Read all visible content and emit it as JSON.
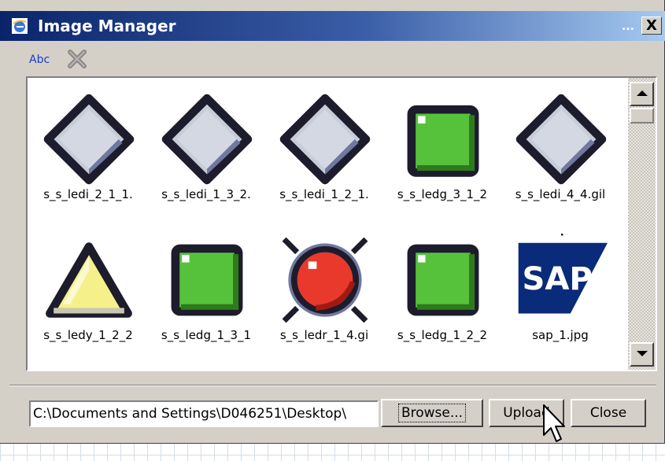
{
  "window": {
    "title": "Image Manager",
    "title_dots": "...",
    "close_glyph": "X",
    "colors": {
      "titlebar_start": "#0a246a",
      "titlebar_end": "#a6caf0",
      "face": "#d4d0c8"
    }
  },
  "toolbar": {
    "spellcheck_icon": "abc-spellcheck-icon",
    "spellcheck_glyph": "Abc",
    "delete_icon": "delete-x-icon"
  },
  "thumbnails": [
    {
      "label": "s_s_ledi_2_1_1.",
      "icon": "led-inactive-diamond"
    },
    {
      "label": "s_s_ledi_1_3_2.",
      "icon": "led-inactive-diamond"
    },
    {
      "label": "s_s_ledi_1_2_1.",
      "icon": "led-inactive-diamond"
    },
    {
      "label": "s_s_ledg_3_1_2",
      "icon": "led-green-square"
    },
    {
      "label": "s_s_ledi_4_4.gil",
      "icon": "led-inactive-diamond"
    },
    {
      "label": "s_s_ledy_1_2_2",
      "icon": "led-yellow-triangle"
    },
    {
      "label": "s_s_ledg_1_3_1",
      "icon": "led-green-square"
    },
    {
      "label": "s_s_ledr_1_4.gi",
      "icon": "led-red-circle"
    },
    {
      "label": "s_s_ledg_1_2_2",
      "icon": "led-green-square"
    },
    {
      "label": "sap_1.jpg",
      "icon": "sap-logo",
      "logo_text": "SAP"
    }
  ],
  "footer": {
    "path_value": "C:\\Documents and Settings\\D046251\\Desktop\\",
    "browse_label": "Browse...",
    "upload_label": "Upload",
    "close_label": "Close"
  }
}
